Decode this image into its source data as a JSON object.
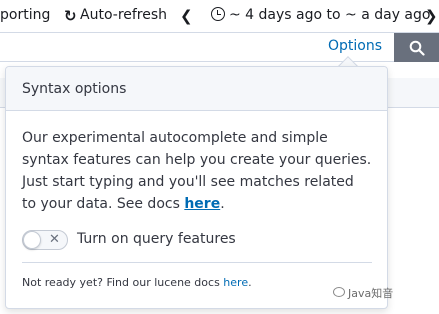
{
  "toolbar": {
    "reporting_label": "porting",
    "refresh_icon": "refresh-icon",
    "refresh_label": "Auto-refresh",
    "prev_icon": "chevron-left-icon",
    "clock_icon": "clock-icon",
    "time_range": "~ 4 days ago to ~ a day ago",
    "next_icon": "chevron-right-icon"
  },
  "query_bar": {
    "options_label": "Options",
    "search_icon": "search-icon"
  },
  "popover": {
    "title": "Syntax options",
    "body_text": "Our experimental autocomplete and simple syntax features can help you create your queries. Just start typing and you'll see matches related to your data. See docs ",
    "body_link": "here",
    "body_end": ".",
    "toggle_state": "off",
    "toggle_off_glyph": "✕",
    "toggle_label": "Turn on query features",
    "footer_text": "Not ready yet? Find our lucene docs ",
    "footer_link": "here",
    "footer_end": "."
  },
  "watermark": {
    "text": "Java知音"
  },
  "colors": {
    "link": "#006bb4",
    "search_button": "#69707d",
    "header_bg": "#f5f7fa",
    "border": "#d3dae6"
  }
}
